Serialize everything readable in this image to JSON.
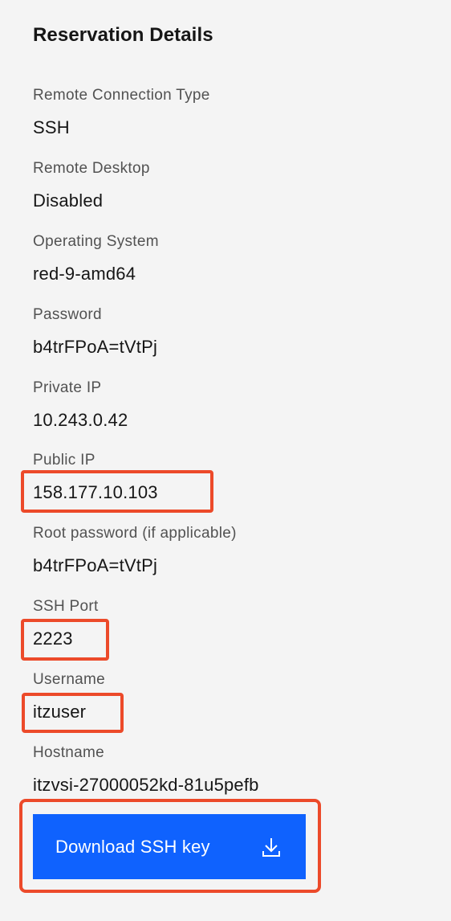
{
  "panel": {
    "title": "Reservation Details"
  },
  "fields": [
    {
      "label": "Remote Connection Type",
      "value": "SSH"
    },
    {
      "label": "Remote Desktop",
      "value": "Disabled"
    },
    {
      "label": "Operating System",
      "value": "red-9-amd64"
    },
    {
      "label": "Password",
      "value": "b4trFPoA=tVtPj"
    },
    {
      "label": "Private IP",
      "value": "10.243.0.42"
    },
    {
      "label": "Public IP",
      "value": "158.177.10.103"
    },
    {
      "label": "Root password (if applicable)",
      "value": "b4trFPoA=tVtPj"
    },
    {
      "label": "SSH Port",
      "value": "2223"
    },
    {
      "label": "Username",
      "value": "itzuser"
    },
    {
      "label": "Hostname",
      "value": "itzvsi-27000052kd-81u5pefb"
    }
  ],
  "download_button": {
    "label": "Download SSH key",
    "icon": "download-icon",
    "color": "#0f62fe"
  },
  "colors": {
    "background": "#f4f4f4",
    "label_text": "#525252",
    "value_text": "#161616",
    "highlight": "#ec4a2a"
  }
}
